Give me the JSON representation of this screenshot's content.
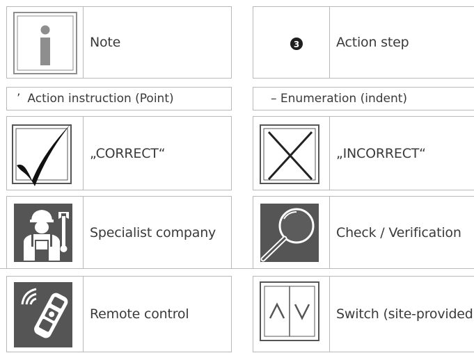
{
  "legend": {
    "note": {
      "label": "Note",
      "icon": "info-icon"
    },
    "action_step": {
      "label": "Action step",
      "number": "3",
      "icon": "numbered-circle-icon"
    },
    "action_instruction": {
      "bullet": "’",
      "label": "Action instruction (Point)"
    },
    "enumeration": {
      "label": "– Enumeration (indent)"
    },
    "correct": {
      "label": "„CORRECT“",
      "icon": "checkmark-icon"
    },
    "incorrect": {
      "label": "„INCORRECT“",
      "icon": "cross-icon"
    },
    "specialist": {
      "label": "Specialist company",
      "icon": "technician-icon"
    },
    "check": {
      "label": "Check / Verification",
      "icon": "magnifier-icon"
    },
    "remote": {
      "label": "Remote control",
      "icon": "remote-control-icon"
    },
    "switch": {
      "label": "Switch (site-provided)",
      "icon": "updown-switch-icon"
    }
  },
  "colors": {
    "border": "#b9b9b9",
    "icon_dark": "#555555",
    "icon_mid": "#8e8e8e",
    "text": "#3a3a3a"
  }
}
